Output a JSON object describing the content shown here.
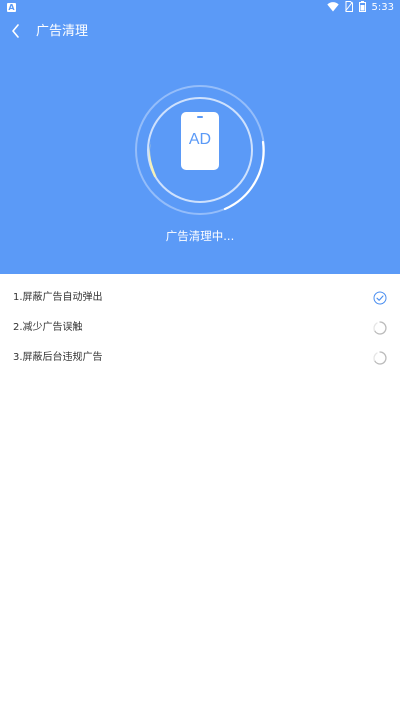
{
  "status_bar": {
    "app_icon_letter": "A",
    "time": "5:33",
    "icons": [
      "wifi-icon",
      "no-sim-icon",
      "battery-icon"
    ]
  },
  "toolbar": {
    "back_icon": "chevron-left-icon",
    "title": "广告清理"
  },
  "scanner": {
    "badge_text": "AD",
    "status_text": "广告清理中..."
  },
  "tasks": [
    {
      "label": "1.屏蔽广告自动弹出",
      "state": "done"
    },
    {
      "label": "2.减少广告误触",
      "state": "loading"
    },
    {
      "label": "3.屏蔽后台违规广告",
      "state": "loading"
    }
  ],
  "colors": {
    "primary": "#5b9af7",
    "text": "#333333",
    "check": "#4a8ef0",
    "spinner": "#bbbbbb"
  }
}
